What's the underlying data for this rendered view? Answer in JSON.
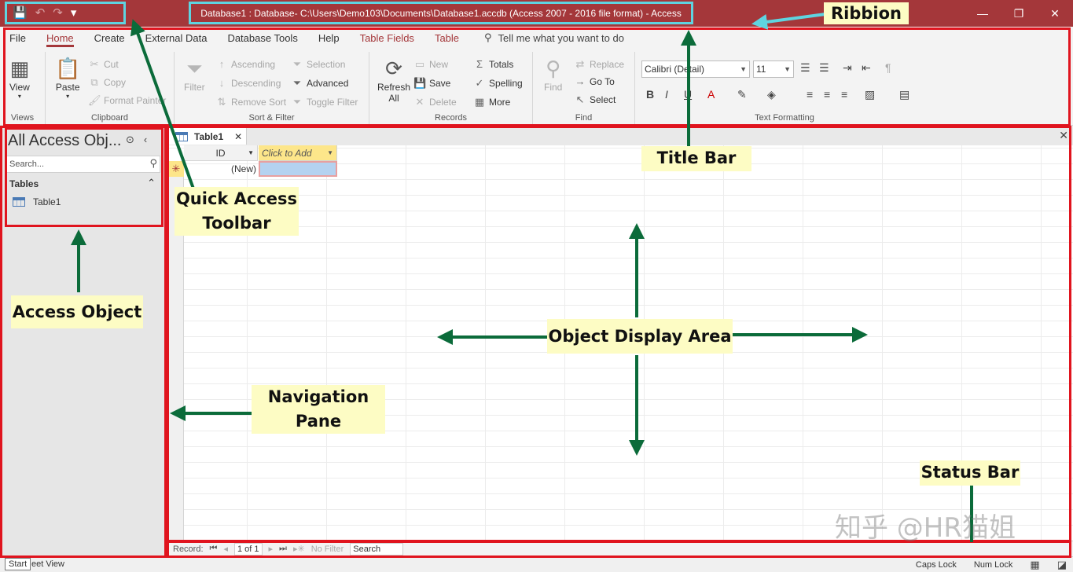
{
  "titlebar": {
    "title": "Database1 : Database- C:\\Users\\Demo103\\Documents\\Database1.accdb (Access 2007 - 2016 file format)  -  Access",
    "qat": {
      "save": "💾",
      "undo": "↶",
      "redo": "↷",
      "customize": "▾"
    },
    "minimize": "—",
    "restore": "❐",
    "close": "✕"
  },
  "ribbon": {
    "tabs": [
      "File",
      "Home",
      "Create",
      "External Data",
      "Database Tools",
      "Help",
      "Table Fields",
      "Table"
    ],
    "tell_me": "Tell me what you want to do",
    "groups": {
      "views": {
        "label": "Views",
        "view": "View"
      },
      "clipboard": {
        "label": "Clipboard",
        "paste": "Paste",
        "cut": "Cut",
        "copy": "Copy",
        "format_painter": "Format Painter"
      },
      "sort_filter": {
        "label": "Sort & Filter",
        "filter": "Filter",
        "ascending": "Ascending",
        "descending": "Descending",
        "remove_sort": "Remove Sort",
        "selection": "Selection",
        "advanced": "Advanced",
        "toggle_filter": "Toggle Filter"
      },
      "records": {
        "label": "Records",
        "refresh": "Refresh",
        "refresh_all": "All",
        "new": "New",
        "save": "Save",
        "delete": "Delete",
        "totals": "Totals",
        "spelling": "Spelling",
        "more": "More"
      },
      "find": {
        "label": "Find",
        "find": "Find",
        "replace": "Replace",
        "goto": "Go To",
        "select": "Select"
      },
      "text_formatting": {
        "label": "Text Formatting",
        "font": "Calibri (Detail)",
        "size": "11"
      }
    }
  },
  "navpane": {
    "title": "All Access Obj...",
    "search_placeholder": "Search...",
    "group": "Tables",
    "items": [
      "Table1"
    ]
  },
  "document": {
    "tab": "Table1",
    "col_id": "ID",
    "col_add": "Click to Add",
    "new_row": "(New)",
    "new_marker": "✳"
  },
  "record_nav": {
    "label": "Record:",
    "position": "1 of 1",
    "no_filter": "No Filter",
    "search": "Search"
  },
  "statusbar": {
    "start": "Start",
    "view": "eet View",
    "caps": "Caps Lock",
    "num": "Num Lock"
  },
  "annotations": {
    "ribbon": "Ribbion",
    "title_bar": "Title Bar",
    "qat_line1": "Quick Access",
    "qat_line2": "Toolbar",
    "access_object": "Access Object",
    "object_display": "Object Display Area",
    "nav_line1": "Navigation",
    "nav_line2": "Pane",
    "status_bar": "Status Bar"
  },
  "watermark": "知乎 @HR猫姐",
  "colors": {
    "accent": "#a4373a",
    "highlight_red": "#e0141e",
    "highlight_cyan": "#5ed4e0",
    "arrow": "#0b6b3a",
    "callout_bg": "#fdfcc4"
  }
}
